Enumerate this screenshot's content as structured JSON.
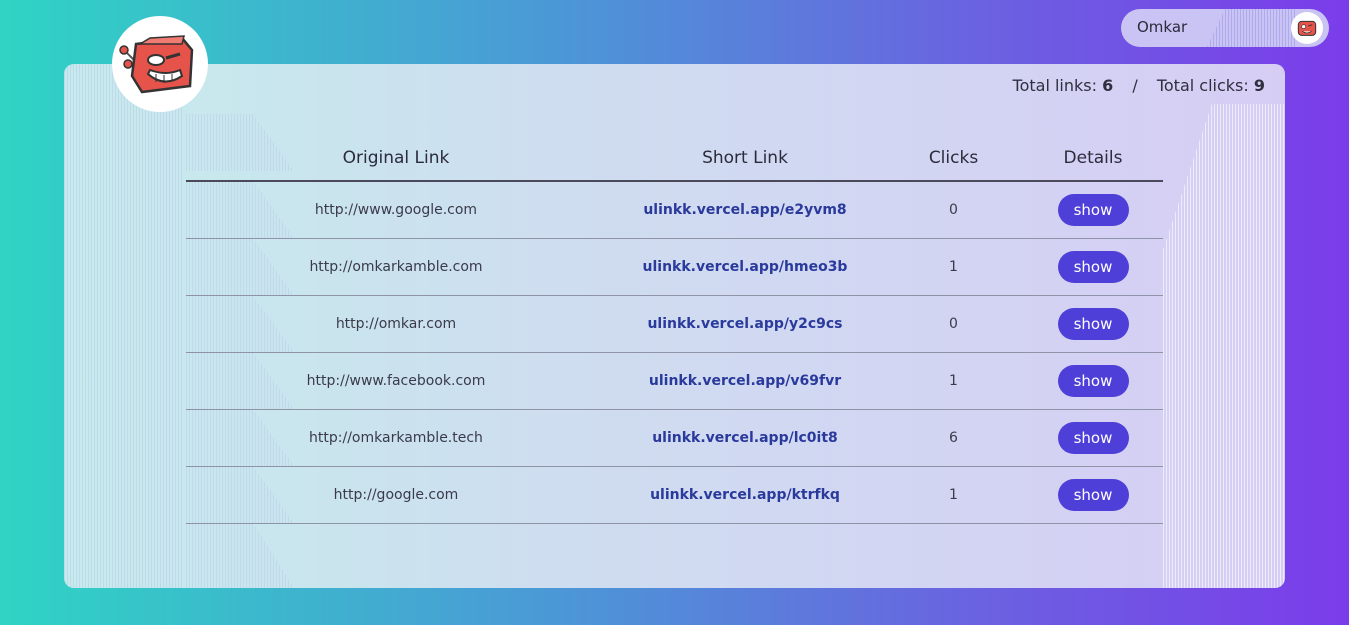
{
  "user": {
    "name": "Omkar"
  },
  "stats": {
    "total_links_label": "Total links:",
    "total_links": "6",
    "separator": "/",
    "total_clicks_label": "Total clicks:",
    "total_clicks": "9"
  },
  "table": {
    "headers": [
      "Original Link",
      "Short Link",
      "Clicks",
      "Details"
    ],
    "rows": [
      {
        "original": "http://www.google.com",
        "short": "ulinkk.vercel.app/e2yvm8",
        "clicks": "0",
        "details": "show"
      },
      {
        "original": "http://omkarkamble.com",
        "short": "ulinkk.vercel.app/hmeo3b",
        "clicks": "1",
        "details": "show"
      },
      {
        "original": "http://omkar.com",
        "short": "ulinkk.vercel.app/y2c9cs",
        "clicks": "0",
        "details": "show"
      },
      {
        "original": "http://www.facebook.com",
        "short": "ulinkk.vercel.app/v69fvr",
        "clicks": "1",
        "details": "show"
      },
      {
        "original": "http://omkarkamble.tech",
        "short": "ulinkk.vercel.app/lc0it8",
        "clicks": "6",
        "details": "show"
      },
      {
        "original": "http://google.com",
        "short": "ulinkk.vercel.app/ktrfkq",
        "clicks": "1",
        "details": "show"
      }
    ]
  },
  "colors": {
    "accent_button": "#4f3fd9",
    "short_link": "#2a3a9c",
    "bg_left": "#2fd4c4",
    "bg_right": "#7b3cea"
  },
  "icons": {
    "logo": "robot-mascot-logo",
    "avatar": "robot-mascot-avatar"
  }
}
